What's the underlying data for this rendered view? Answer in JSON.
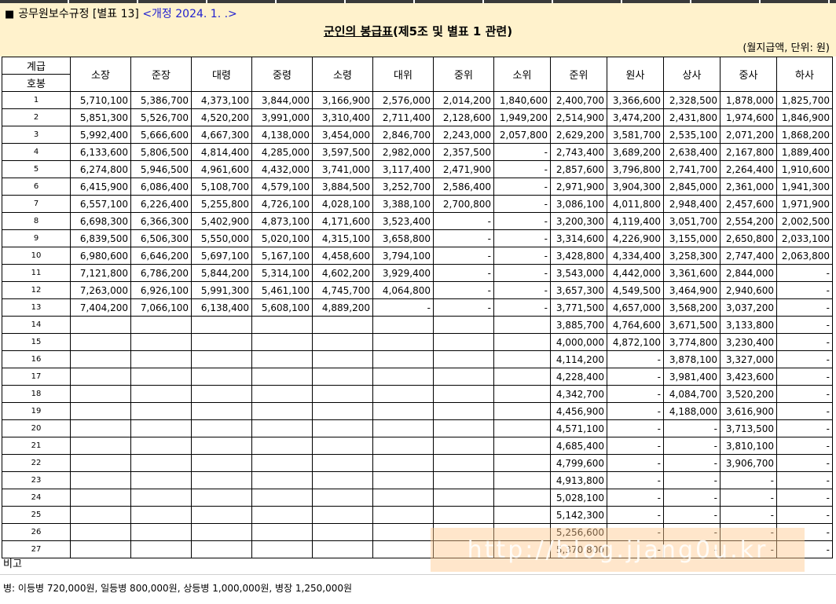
{
  "header": {
    "square": "■",
    "law_title": "공무원보수규정 [별표 13]",
    "amend": "<개정 2024. 1. .>",
    "title_underlined": "군인의 봉급표",
    "title_rest": "(제5조 및 별표 1 관련)",
    "unit": "(월지급액, 단위: 원)"
  },
  "table": {
    "corner_top": "계급",
    "corner_bottom": "호봉",
    "ranks": [
      "소장",
      "준장",
      "대령",
      "중령",
      "소령",
      "대위",
      "중위",
      "소위",
      "준위",
      "원사",
      "상사",
      "중사",
      "하사"
    ],
    "rows": [
      {
        "step": "1",
        "values": [
          "5,710,100",
          "5,386,700",
          "4,373,100",
          "3,844,000",
          "3,166,900",
          "2,576,000",
          "2,014,200",
          "1,840,600",
          "2,400,700",
          "3,366,600",
          "2,328,500",
          "1,878,000",
          "1,825,700"
        ]
      },
      {
        "step": "2",
        "values": [
          "5,851,300",
          "5,526,700",
          "4,520,200",
          "3,991,000",
          "3,310,400",
          "2,711,400",
          "2,128,600",
          "1,949,200",
          "2,514,900",
          "3,474,200",
          "2,431,800",
          "1,974,600",
          "1,846,900"
        ]
      },
      {
        "step": "3",
        "values": [
          "5,992,400",
          "5,666,600",
          "4,667,300",
          "4,138,000",
          "3,454,000",
          "2,846,700",
          "2,243,000",
          "2,057,800",
          "2,629,200",
          "3,581,700",
          "2,535,100",
          "2,071,200",
          "1,868,200"
        ]
      },
      {
        "step": "4",
        "values": [
          "6,133,600",
          "5,806,500",
          "4,814,400",
          "4,285,000",
          "3,597,500",
          "2,982,000",
          "2,357,500",
          "-",
          "2,743,400",
          "3,689,200",
          "2,638,400",
          "2,167,800",
          "1,889,400"
        ]
      },
      {
        "step": "5",
        "values": [
          "6,274,800",
          "5,946,500",
          "4,961,600",
          "4,432,000",
          "3,741,000",
          "3,117,400",
          "2,471,900",
          "-",
          "2,857,600",
          "3,796,800",
          "2,741,700",
          "2,264,400",
          "1,910,600"
        ]
      },
      {
        "step": "6",
        "values": [
          "6,415,900",
          "6,086,400",
          "5,108,700",
          "4,579,100",
          "3,884,500",
          "3,252,700",
          "2,586,400",
          "-",
          "2,971,900",
          "3,904,300",
          "2,845,000",
          "2,361,000",
          "1,941,300"
        ]
      },
      {
        "step": "7",
        "values": [
          "6,557,100",
          "6,226,400",
          "5,255,800",
          "4,726,100",
          "4,028,100",
          "3,388,100",
          "2,700,800",
          "-",
          "3,086,100",
          "4,011,800",
          "2,948,400",
          "2,457,600",
          "1,971,900"
        ]
      },
      {
        "step": "8",
        "values": [
          "6,698,300",
          "6,366,300",
          "5,402,900",
          "4,873,100",
          "4,171,600",
          "3,523,400",
          "-",
          "-",
          "3,200,300",
          "4,119,400",
          "3,051,700",
          "2,554,200",
          "2,002,500"
        ]
      },
      {
        "step": "9",
        "values": [
          "6,839,500",
          "6,506,300",
          "5,550,000",
          "5,020,100",
          "4,315,100",
          "3,658,800",
          "-",
          "-",
          "3,314,600",
          "4,226,900",
          "3,155,000",
          "2,650,800",
          "2,033,100"
        ]
      },
      {
        "step": "10",
        "values": [
          "6,980,600",
          "6,646,200",
          "5,697,100",
          "5,167,100",
          "4,458,600",
          "3,794,100",
          "-",
          "-",
          "3,428,800",
          "4,334,400",
          "3,258,300",
          "2,747,400",
          "2,063,800"
        ]
      },
      {
        "step": "11",
        "values": [
          "7,121,800",
          "6,786,200",
          "5,844,200",
          "5,314,100",
          "4,602,200",
          "3,929,400",
          "-",
          "-",
          "3,543,000",
          "4,442,000",
          "3,361,600",
          "2,844,000",
          "-"
        ]
      },
      {
        "step": "12",
        "values": [
          "7,263,000",
          "6,926,100",
          "5,991,300",
          "5,461,100",
          "4,745,700",
          "4,064,800",
          "-",
          "-",
          "3,657,300",
          "4,549,500",
          "3,464,900",
          "2,940,600",
          "-"
        ]
      },
      {
        "step": "13",
        "values": [
          "7,404,200",
          "7,066,100",
          "6,138,400",
          "5,608,100",
          "4,889,200",
          "-",
          "-",
          "-",
          "3,771,500",
          "4,657,000",
          "3,568,200",
          "3,037,200",
          "-"
        ]
      },
      {
        "step": "14",
        "values": [
          "",
          "",
          "",
          "",
          "",
          "",
          "",
          "",
          "3,885,700",
          "4,764,600",
          "3,671,500",
          "3,133,800",
          "-"
        ]
      },
      {
        "step": "15",
        "values": [
          "",
          "",
          "",
          "",
          "",
          "",
          "",
          "",
          "4,000,000",
          "4,872,100",
          "3,774,800",
          "3,230,400",
          "-"
        ]
      },
      {
        "step": "16",
        "values": [
          "",
          "",
          "",
          "",
          "",
          "",
          "",
          "",
          "4,114,200",
          "-",
          "3,878,100",
          "3,327,000",
          "-"
        ]
      },
      {
        "step": "17",
        "values": [
          "",
          "",
          "",
          "",
          "",
          "",
          "",
          "",
          "4,228,400",
          "-",
          "3,981,400",
          "3,423,600",
          "-"
        ]
      },
      {
        "step": "18",
        "values": [
          "",
          "",
          "",
          "",
          "",
          "",
          "",
          "",
          "4,342,700",
          "-",
          "4,084,700",
          "3,520,200",
          "-"
        ]
      },
      {
        "step": "19",
        "values": [
          "",
          "",
          "",
          "",
          "",
          "",
          "",
          "",
          "4,456,900",
          "-",
          "4,188,000",
          "3,616,900",
          "-"
        ]
      },
      {
        "step": "20",
        "values": [
          "",
          "",
          "",
          "",
          "",
          "",
          "",
          "",
          "4,571,100",
          "-",
          "-",
          "3,713,500",
          "-"
        ]
      },
      {
        "step": "21",
        "values": [
          "",
          "",
          "",
          "",
          "",
          "",
          "",
          "",
          "4,685,400",
          "-",
          "-",
          "3,810,100",
          "-"
        ]
      },
      {
        "step": "22",
        "values": [
          "",
          "",
          "",
          "",
          "",
          "",
          "",
          "",
          "4,799,600",
          "-",
          "-",
          "3,906,700",
          "-"
        ]
      },
      {
        "step": "23",
        "values": [
          "",
          "",
          "",
          "",
          "",
          "",
          "",
          "",
          "4,913,800",
          "-",
          "-",
          "-",
          "-"
        ]
      },
      {
        "step": "24",
        "values": [
          "",
          "",
          "",
          "",
          "",
          "",
          "",
          "",
          "5,028,100",
          "-",
          "-",
          "-",
          "-"
        ]
      },
      {
        "step": "25",
        "values": [
          "",
          "",
          "",
          "",
          "",
          "",
          "",
          "",
          "5,142,300",
          "-",
          "-",
          "-",
          "-"
        ]
      },
      {
        "step": "26",
        "values": [
          "",
          "",
          "",
          "",
          "",
          "",
          "",
          "",
          "5,256,600",
          "-",
          "-",
          "-",
          "-"
        ]
      },
      {
        "step": "27",
        "values": [
          "",
          "",
          "",
          "",
          "",
          "",
          "",
          "",
          "5,370,800",
          "-",
          "-",
          "-",
          "-"
        ]
      }
    ]
  },
  "remark": {
    "label": "비고",
    "text": "병: 이등병 720,000원, 일등병 800,000원, 상등병 1,000,000원, 병장 1,250,000원"
  },
  "watermark": {
    "text": "http://blog.jjang0u.kr"
  }
}
